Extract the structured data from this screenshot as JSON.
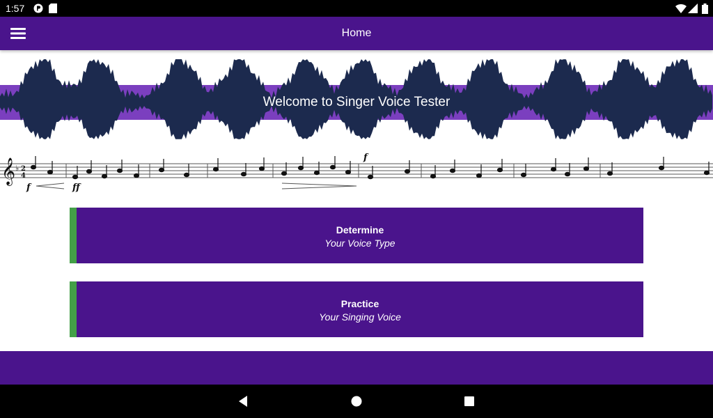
{
  "status_bar": {
    "time": "1:57",
    "icons": [
      "notification-p-icon",
      "sd-card-icon",
      "wifi-icon",
      "signal-icon",
      "battery-icon"
    ]
  },
  "app_bar": {
    "title": "Home",
    "menu_icon": "hamburger-menu-icon",
    "background": "#4a148c"
  },
  "banner": {
    "welcome_text": "Welcome to Singer Voice Tester",
    "stripe_color": "#7b3fbf",
    "wave_color": "#1c2a4e"
  },
  "actions": [
    {
      "title": "Determine",
      "subtitle": "Your Voice Type"
    },
    {
      "title": "Practice",
      "subtitle": "Your Singing Voice"
    }
  ],
  "accent_color": "#43a047",
  "nav_bar": {
    "icons": [
      "back-icon",
      "home-icon",
      "recents-icon"
    ]
  }
}
